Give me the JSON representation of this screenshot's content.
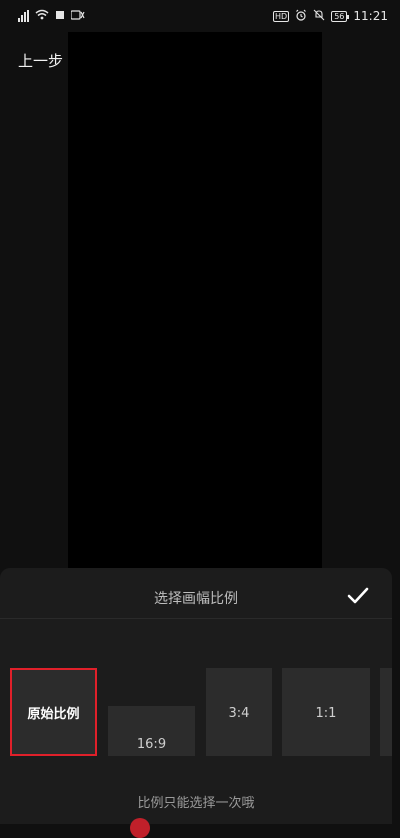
{
  "status_bar": {
    "time": "11:21",
    "hd": "HD",
    "battery": "56"
  },
  "nav": {
    "back_label": "上一步"
  },
  "sheet": {
    "title": "选择画幅比例",
    "hint": "比例只能选择一次哦",
    "ratios": [
      {
        "label": "原始比例",
        "selected": true
      },
      {
        "label": "16:9",
        "selected": false
      },
      {
        "label": "3:4",
        "selected": false
      },
      {
        "label": "1:1",
        "selected": false
      }
    ]
  },
  "colors": {
    "accent": "#e0202a",
    "background": "#101010",
    "sheet": "#1c1c1c",
    "tile": "#2c2c2c"
  }
}
